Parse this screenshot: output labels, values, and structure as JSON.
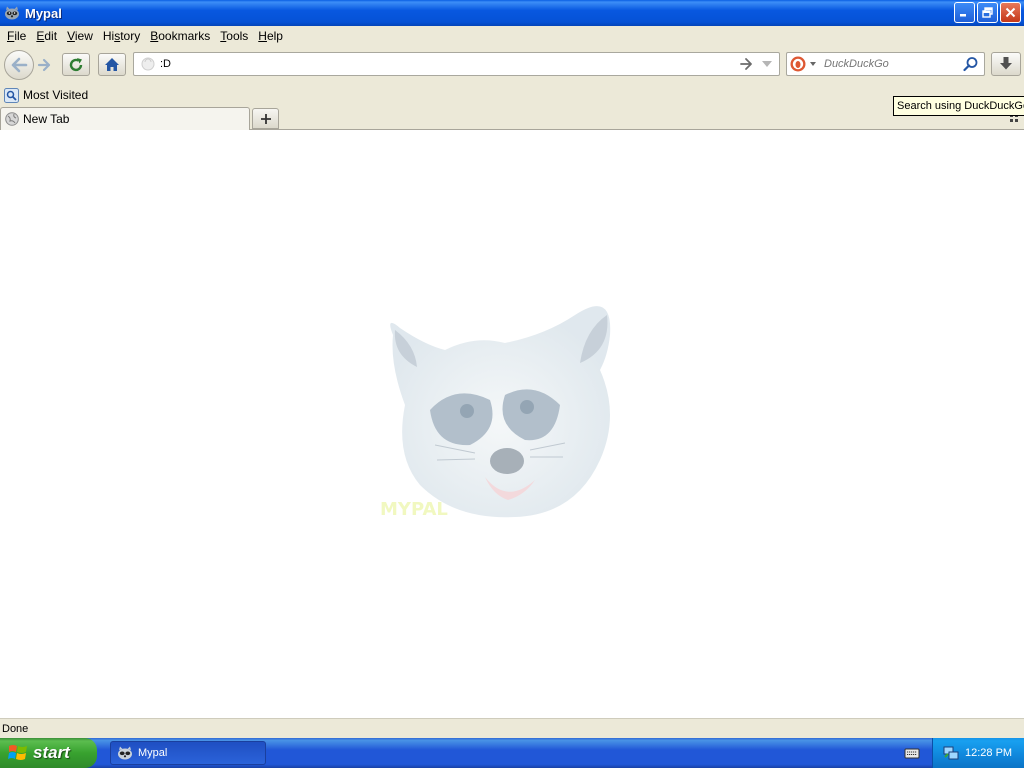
{
  "window": {
    "title": "Mypal",
    "app_icon": "raccoon-icon",
    "controls": [
      "minimize-icon",
      "restore-icon",
      "close-icon"
    ]
  },
  "menubar": {
    "items": [
      {
        "label": "File",
        "accesskey": "F"
      },
      {
        "label": "Edit",
        "accesskey": "E"
      },
      {
        "label": "View",
        "accesskey": "V"
      },
      {
        "label": "History",
        "accesskey": "s"
      },
      {
        "label": "Bookmarks",
        "accesskey": "B"
      },
      {
        "label": "Tools",
        "accesskey": "T"
      },
      {
        "label": "Help",
        "accesskey": "H"
      }
    ]
  },
  "navbar": {
    "url_value": ":D",
    "search_placeholder": "DuckDuckGo",
    "search_engine_icon": "duckduckgo-icon"
  },
  "bookmarks": {
    "items": [
      {
        "label": "Most Visited",
        "icon": "bookmark-folder-icon"
      }
    ]
  },
  "tooltip": {
    "text": "Search using DuckDuckGo"
  },
  "tabs": [
    {
      "label": "New Tab",
      "active": true,
      "icon": "globe-icon"
    }
  ],
  "content": {
    "logo": "mypal-raccoon-logo",
    "logo_text": "MYPAL"
  },
  "statusbar": {
    "text": "Done"
  },
  "taskbar": {
    "start_label": "start",
    "tasks": [
      {
        "label": "Mypal",
        "icon": "raccoon-icon"
      }
    ],
    "clock": "12:28 PM"
  },
  "colors": {
    "titlebar": "#0552d6",
    "chrome": "#ece9d8",
    "taskbar": "#2157d7",
    "start_button": "#38a22f",
    "tray": "#0f86db"
  }
}
